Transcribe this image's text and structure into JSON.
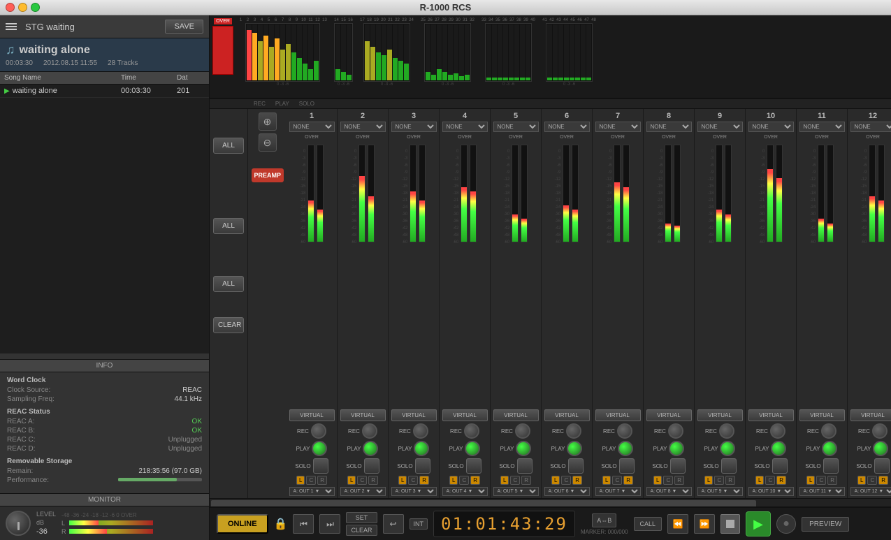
{
  "window": {
    "title": "R-1000 RCS"
  },
  "left_panel": {
    "stg_title": "STG waiting",
    "save_btn": "SAVE",
    "song_name": "waiting alone",
    "song_time": "00:03:30",
    "song_date": "2012.08.15  11:55",
    "song_tracks": "28 Tracks",
    "track_list_header": {
      "name": "Song Name",
      "time": "Time",
      "dat": "Dat"
    },
    "tracks": [
      {
        "name": "waiting alone",
        "time": "00:03:30",
        "dat": "201"
      }
    ],
    "info": {
      "title": "INFO",
      "word_clock": {
        "label": "Word Clock",
        "clock_source_label": "Clock Source:",
        "clock_source_value": "REAC",
        "sampling_freq_label": "Sampling Freq:",
        "sampling_freq_value": "44.1 kHz"
      },
      "reac_status": {
        "label": "REAC Status",
        "reac_a_label": "REAC A:",
        "reac_a_value": "OK",
        "reac_b_label": "REAC B:",
        "reac_b_value": "OK",
        "reac_c_label": "REAC C:",
        "reac_c_value": "Unplugged",
        "reac_d_label": "REAC D:",
        "reac_d_value": "Unplugged"
      },
      "storage": {
        "label": "Removable Storage",
        "remain_label": "Remain:",
        "remain_value": "218:35:56 (97.0 GB)",
        "perf_label": "Performance:"
      }
    },
    "monitor": {
      "title": "MONITOR",
      "level_label": "LEVEL",
      "db_label": "dB",
      "level_value": "-36",
      "meter_scale": "-48 -36 -24 -18 -12 -6  0  OVER"
    }
  },
  "channels": [
    {
      "num": "1",
      "select": "NONE"
    },
    {
      "num": "2",
      "select": "NONE"
    },
    {
      "num": "3",
      "select": "NONE"
    },
    {
      "num": "4",
      "select": "NONE"
    },
    {
      "num": "5",
      "select": "NONE"
    },
    {
      "num": "6",
      "select": "NONE"
    },
    {
      "num": "7",
      "select": "NONE"
    },
    {
      "num": "8",
      "select": "NONE"
    },
    {
      "num": "9",
      "select": "NONE"
    },
    {
      "num": "10",
      "select": "NONE"
    },
    {
      "num": "11",
      "select": "NONE"
    },
    {
      "num": "12",
      "select": "NONE"
    }
  ],
  "channel_outputs": [
    "A: OUT 1",
    "A: OUT 2",
    "A: OUT 3",
    "A: OUT 4",
    "A: OUT 5",
    "A: OUT 6",
    "A: OUT 7",
    "A: OUT 8",
    "A: OUT 9",
    "A: OUT 10",
    "A: OUT 11",
    "A: OUT 12"
  ],
  "fader_heights": [
    0.45,
    0.72,
    0.55,
    0.6,
    0.3,
    0.4,
    0.65,
    0.2,
    0.35,
    0.8,
    0.25,
    0.5
  ],
  "fader_heights2": [
    0.35,
    0.5,
    0.45,
    0.55,
    0.25,
    0.35,
    0.6,
    0.18,
    0.3,
    0.7,
    0.2,
    0.45
  ],
  "lcr_active": [
    {
      "l": true,
      "c": false,
      "r": false
    },
    {
      "l": true,
      "c": false,
      "r": false
    },
    {
      "l": true,
      "c": false,
      "r": true
    },
    {
      "l": true,
      "c": false,
      "r": true
    },
    {
      "l": true,
      "c": false,
      "r": false
    },
    {
      "l": true,
      "c": false,
      "r": true
    },
    {
      "l": true,
      "c": false,
      "r": true
    },
    {
      "l": true,
      "c": false,
      "r": false
    },
    {
      "l": true,
      "c": false,
      "r": false
    },
    {
      "l": true,
      "c": false,
      "r": true
    },
    {
      "l": true,
      "c": false,
      "r": false
    },
    {
      "l": true,
      "c": false,
      "r": true
    }
  ],
  "buttons": {
    "all_labels": [
      "ALL",
      "ALL",
      "ALL"
    ],
    "clear_label": "CLEAR",
    "preamp_label": "PREAMP",
    "virtual_label": "VIRTUAL"
  },
  "transport": {
    "online_label": "ONLINE",
    "set_label": "SET",
    "clear_label": "CLEAR",
    "int_label": "INT",
    "timecode": "01:01:43:29",
    "ab_label": "A⇔B",
    "call_label": "CALL",
    "preview_label": "PREVIEW",
    "marker_label": "MARKER: 000/000"
  },
  "top_meters": {
    "groups": [
      {
        "start": 1,
        "end": 13,
        "bars": [
          0.9,
          0.85,
          0.7,
          0.8,
          0.6,
          0.75,
          0.55,
          0.65,
          0.5,
          0.4,
          0.3,
          0.2,
          0.35
        ]
      },
      {
        "start": 14,
        "end": 16,
        "bars": [
          0.2,
          0.15,
          0.1
        ]
      },
      {
        "start": 17,
        "end": 24,
        "bars": [
          0.7,
          0.6,
          0.5,
          0.45,
          0.55,
          0.4,
          0.35,
          0.3
        ]
      },
      {
        "start": 25,
        "end": 32,
        "bars": [
          0.15,
          0.1,
          0.2,
          0.15,
          0.1,
          0.12,
          0.08,
          0.1
        ]
      },
      {
        "start": 33,
        "end": 40,
        "bars": [
          0.05,
          0.05,
          0.05,
          0.05,
          0.05,
          0.05,
          0.05,
          0.05
        ]
      },
      {
        "start": 41,
        "end": 48,
        "bars": [
          0.05,
          0.05,
          0.05,
          0.05,
          0.05,
          0.05,
          0.05,
          0.05
        ]
      }
    ]
  }
}
